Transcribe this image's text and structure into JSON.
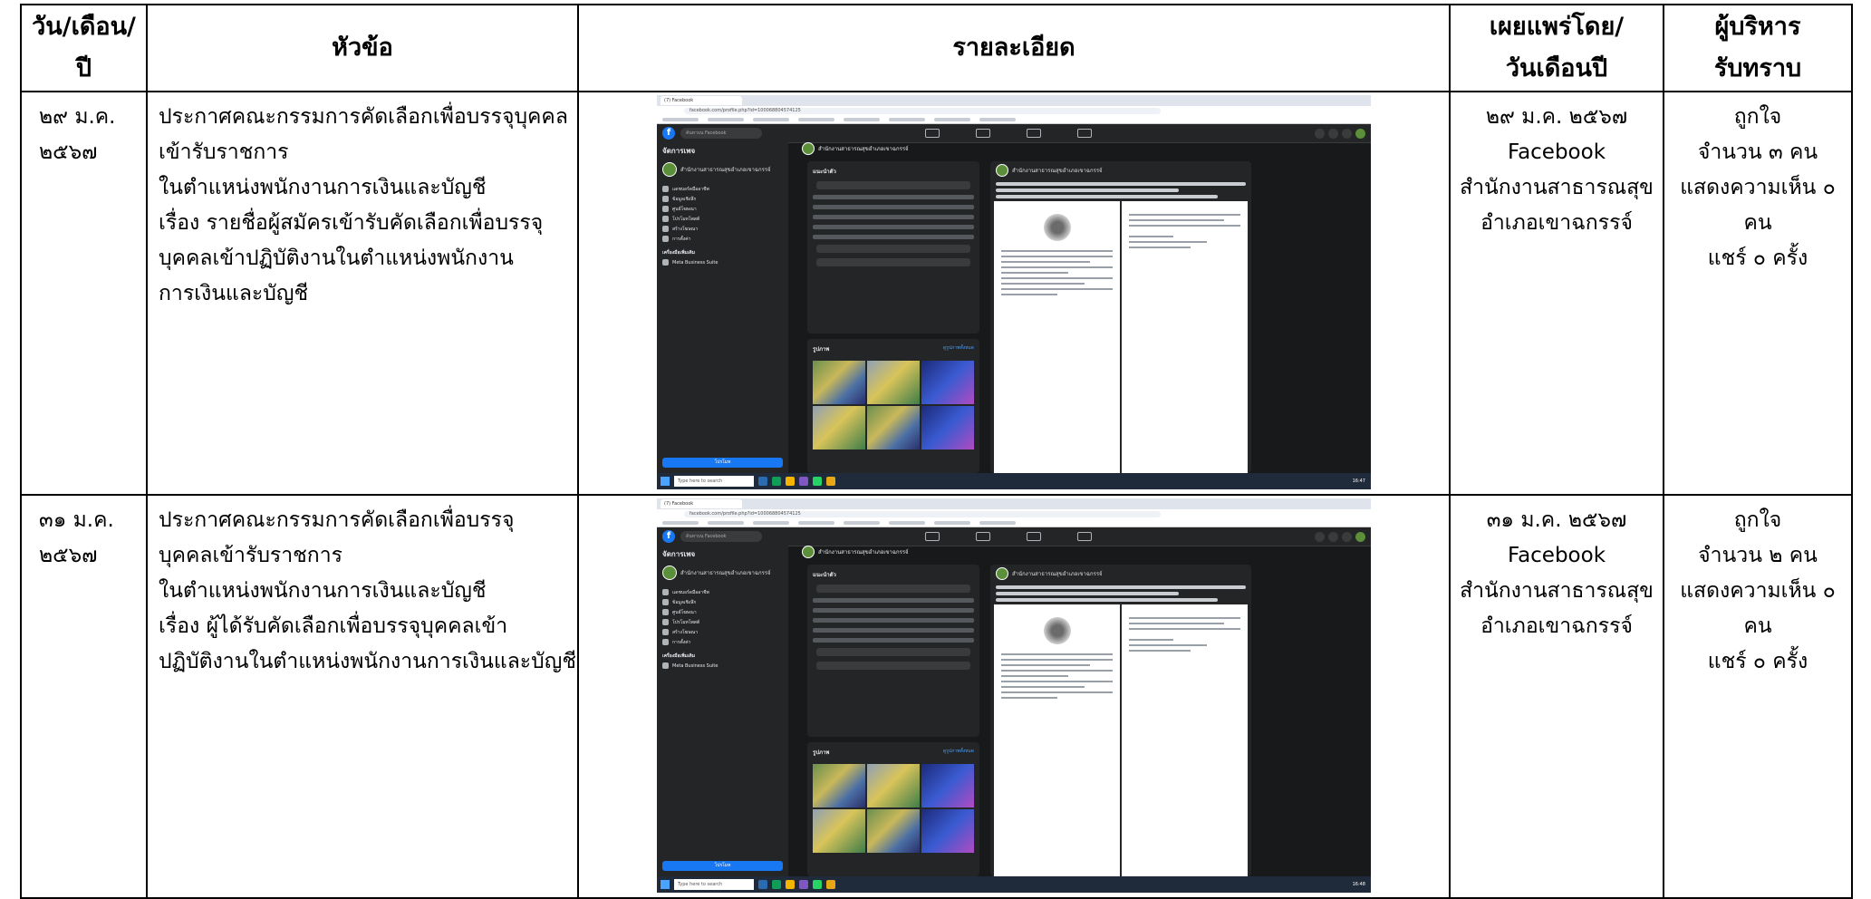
{
  "headers": {
    "date": [
      "วัน/เดือน/",
      "ปี"
    ],
    "topic": "หัวข้อ",
    "detail": "รายละเอียด",
    "publisher": [
      "เผยแพร่โดย/",
      "วันเดือนปี"
    ],
    "acknowledged": [
      "ผู้บริหาร",
      "รับทราบ"
    ]
  },
  "rows": [
    {
      "date": [
        "๒๙ ม.ค.",
        "๒๕๖๗"
      ],
      "topic": [
        "ประกาศคณะกรรมการคัดเลือกเพื่อบรรจุบุคคล",
        "เข้ารับราชการ",
        "ในตำแหน่งพนักงานการเงินและบัญชี",
        "เรื่อง รายชื่อผู้สมัครเข้ารับคัดเลือกเพื่อบรรจุ",
        "บุคคลเข้าปฏิบัติงานในตำแหน่งพนักงาน",
        "การเงินและบัญชี"
      ],
      "publisher": [
        "๒๙ ม.ค. ๒๕๖๗",
        "Facebook",
        "สำนักงานสาธารณสุข",
        "อำเภอเขาฉกรรจ์"
      ],
      "acknowledged": [
        "ถูกใจ",
        "จำนวน ๓ คน",
        "แสดงความเห็น ๐",
        "คน",
        "แชร์ ๐ ครั้ง"
      ],
      "screenshot": {
        "tab": "(7) Facebook",
        "url": "facebook.com/profile.php?id=100068804574125",
        "search": "ค้นหาบน Facebook",
        "sidebar_title": "จัดการเพจ",
        "page_name": "สำนักงานสาธารณสุขอำเภอเขาฉกรรจ์",
        "sidebar_items": [
          "แดชบอร์ดมืออาชีพ",
          "ข้อมูลเชิงลึก",
          "ศูนย์โฆษณา",
          "โปรโมทโพสต์",
          "สร้างโฆษณา",
          "การตั้งค่า"
        ],
        "more_tools": "เครื่องมือเพิ่มเติม",
        "meta_suite": "Meta Business Suite",
        "promote": "โปรโมท",
        "intro": "แนะนำตัว",
        "photos": "รูปภาพ",
        "see_all": "ดูรูปภาพทั้งหมด",
        "taskbar_search": "Type here to search",
        "clock": "16:47"
      }
    },
    {
      "date": [
        "๓๑ ม.ค.",
        "๒๕๖๗"
      ],
      "topic": [
        "ประกาศคณะกรรมการคัดเลือกเพื่อบรรจุ",
        "บุคคลเข้ารับราชการ",
        "ในตำแหน่งพนักงานการเงินและบัญชี",
        "เรื่อง ผู้ได้รับคัดเลือกเพื่อบรรจุบุคคลเข้า",
        "ปฏิบัติงานในตำแหน่งพนักงานการเงินและบัญชี"
      ],
      "publisher": [
        "๓๑ ม.ค. ๒๕๖๗",
        "Facebook",
        "สำนักงานสาธารณสุข",
        "อำเภอเขาฉกรรจ์"
      ],
      "acknowledged": [
        "ถูกใจ",
        "จำนวน ๒ คน",
        "แสดงความเห็น ๐",
        "คน",
        "แชร์ ๐ ครั้ง"
      ],
      "screenshot": {
        "tab": "(7) Facebook",
        "url": "facebook.com/profile.php?id=100068804574125",
        "search": "ค้นหาบน Facebook",
        "sidebar_title": "จัดการเพจ",
        "page_name": "สำนักงานสาธารณสุขอำเภอเขาฉกรรจ์",
        "sidebar_items": [
          "แดชบอร์ดมืออาชีพ",
          "ข้อมูลเชิงลึก",
          "ศูนย์โฆษณา",
          "โปรโมทโพสต์",
          "สร้างโฆษณา",
          "การตั้งค่า"
        ],
        "more_tools": "เครื่องมือเพิ่มเติม",
        "meta_suite": "Meta Business Suite",
        "promote": "โปรโมท",
        "intro": "แนะนำตัว",
        "photos": "รูปภาพ",
        "see_all": "ดูรูปภาพทั้งหมด",
        "taskbar_search": "Type here to search",
        "clock": "16:48"
      }
    }
  ]
}
